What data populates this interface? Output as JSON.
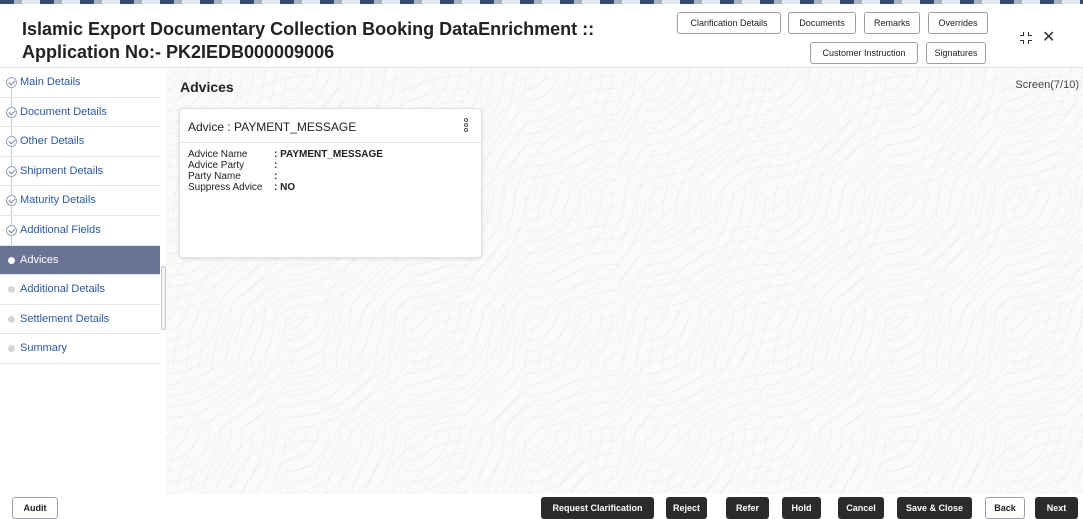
{
  "header": {
    "title_line1": "Islamic Export Documentary Collection Booking DataEnrichment ::",
    "title_line2": "Application No:- PK2IEDB000009006",
    "buttons": {
      "clarification": "Clarification Details",
      "documents": "Documents",
      "remarks": "Remarks",
      "overrides": "Overrides",
      "customer_instruction": "Customer Instruction",
      "signatures": "Signatures"
    },
    "close_glyph": "✕"
  },
  "sidebar": {
    "items": [
      {
        "label": "Main Details",
        "state": "done",
        "icon": "check-circle-icon"
      },
      {
        "label": "Document Details",
        "state": "done",
        "icon": "check-circle-icon"
      },
      {
        "label": "Other Details",
        "state": "done",
        "icon": "check-circle-icon"
      },
      {
        "label": "Shipment Details",
        "state": "done",
        "icon": "check-circle-icon"
      },
      {
        "label": "Maturity Details",
        "state": "done",
        "icon": "check-circle-icon"
      },
      {
        "label": "Additional Fields",
        "state": "done",
        "icon": "check-circle-icon"
      },
      {
        "label": "Advices",
        "state": "active",
        "icon": "dot-icon"
      },
      {
        "label": "Additional Details",
        "state": "pending",
        "icon": "dot-icon"
      },
      {
        "label": "Settlement Details",
        "state": "pending",
        "icon": "dot-icon"
      },
      {
        "label": "Summary",
        "state": "pending",
        "icon": "dot-icon"
      }
    ]
  },
  "main": {
    "title": "Advices",
    "screen_counter": "Screen(7/10)",
    "card": {
      "title": "Advice : PAYMENT_MESSAGE",
      "fields": [
        {
          "label": "Advice Name",
          "value": ": PAYMENT_MESSAGE"
        },
        {
          "label": "Advice Party",
          "value": ":"
        },
        {
          "label": "Party Name",
          "value": ":"
        },
        {
          "label": "Suppress Advice",
          "value": ": NO"
        }
      ]
    }
  },
  "footer": {
    "audit": "Audit",
    "request_clarification": "Request Clarification",
    "reject": "Reject",
    "refer": "Refer",
    "hold": "Hold",
    "cancel": "Cancel",
    "save_close": "Save & Close",
    "back": "Back",
    "next": "Next"
  },
  "colors": {
    "sidebar_active": "#6a7394",
    "link_blue": "#2c5aa0",
    "dark_button": "#2b2b2b"
  }
}
